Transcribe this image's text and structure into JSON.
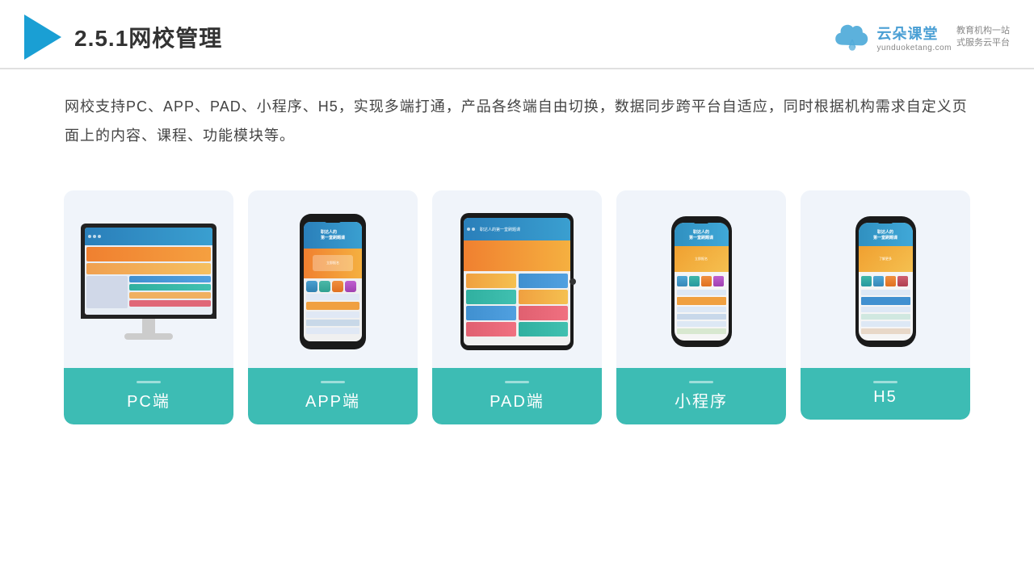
{
  "header": {
    "title": "2.5.1网校管理",
    "brand_name": "云朵课堂",
    "brand_url": "yunduoketang.com",
    "brand_slogan": "教育机构一站\n式服务云平台"
  },
  "description": "网校支持PC、APP、PAD、小程序、H5，实现多端打通，产品各终端自由切换，数据同步跨平台自适应，同时根据机构需求自定义页面上的内容、课程、功能模块等。",
  "cards": [
    {
      "id": "pc",
      "label": "PC端"
    },
    {
      "id": "app",
      "label": "APP端"
    },
    {
      "id": "pad",
      "label": "PAD端"
    },
    {
      "id": "mini",
      "label": "小程序"
    },
    {
      "id": "h5",
      "label": "H5"
    }
  ],
  "colors": {
    "teal": "#3dbcb4",
    "header_blue": "#3a9fd0",
    "accent_orange": "#f08030"
  }
}
